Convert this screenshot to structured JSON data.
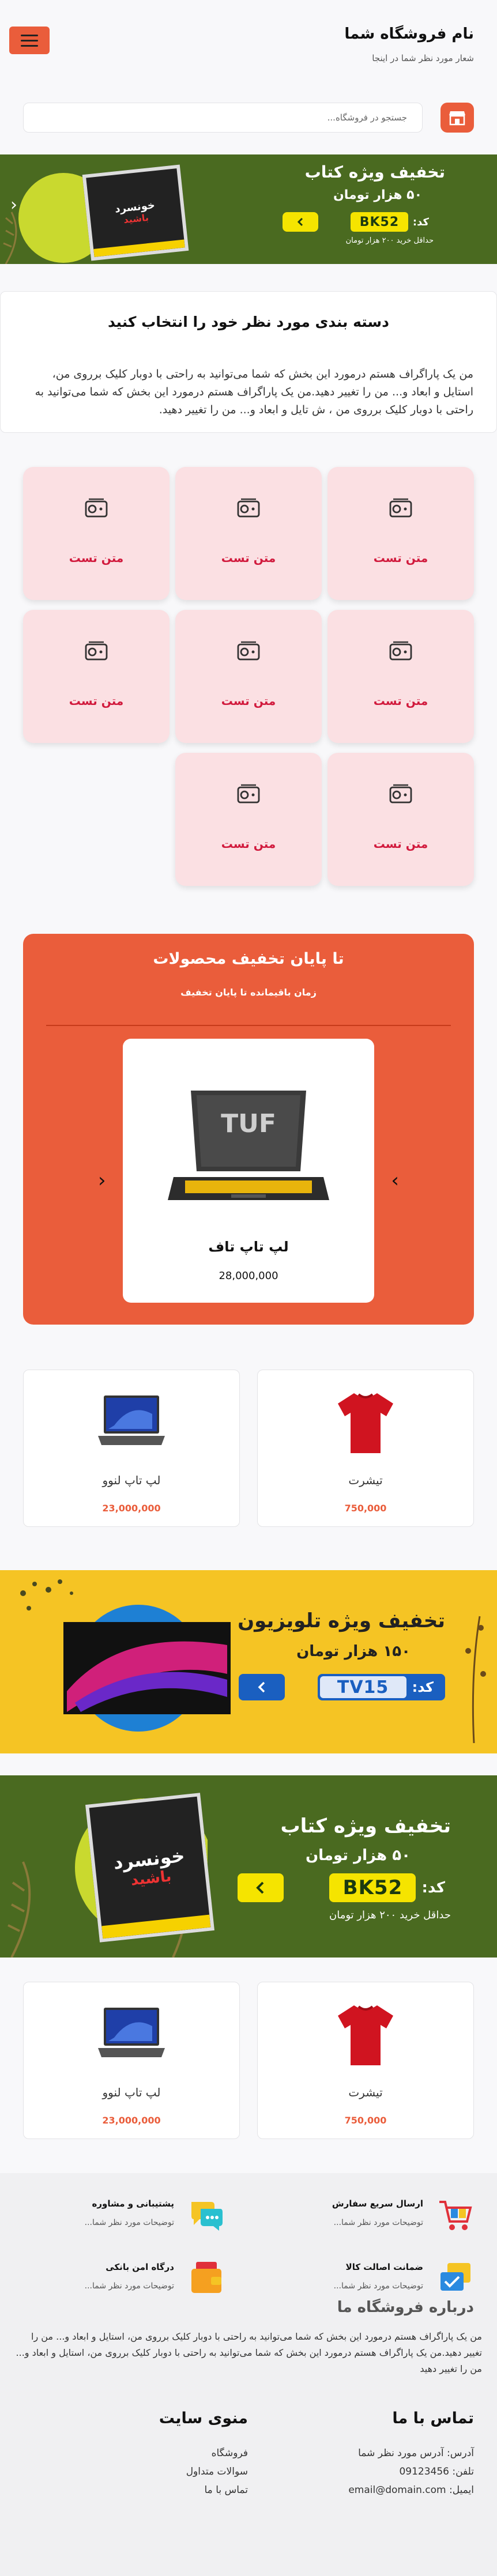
{
  "header": {
    "store_name": "نام فروشگاه شما",
    "slogan": "شعار مورد نظر شما در اینجا"
  },
  "search": {
    "placeholder": "جستجو در فروشگاه..."
  },
  "banner_book": {
    "title": "تخفیف ویژه کتاب",
    "amount": "۵۰ هزار تومان",
    "code_label": "کد:",
    "code": "BK52",
    "note": "حداقل خرید ۲۰۰ هزار تومان"
  },
  "banner_tv": {
    "title": "تخفیف ویژه تلویزیون",
    "amount": "۱۵۰ هزار تومان",
    "code_label": "کد:",
    "code": "TV15"
  },
  "categories": {
    "title": "دسته بندی مورد نظر خود را انتخاب کنید",
    "text": "من یک پاراگراف هستم درمورد این بخش که شما می‌توانید به راحتی با دوبار کلیک برروی من، استایل و ابعاد و... من را تغییر دهید.من یک پاراگراف هستم درمورد این بخش که شما می‌توانید به راحتی با دوبار کلیک برروی من ، ش تایل و ابعاد و... من را تغییر دهید.",
    "items": [
      {
        "label": "متن تست",
        "icon": "radio-icon"
      },
      {
        "label": "متن تست",
        "icon": "radio-icon"
      },
      {
        "label": "متن تست",
        "icon": "radio-icon"
      },
      {
        "label": "متن تست",
        "icon": "radio-icon"
      },
      {
        "label": "متن تست",
        "icon": "radio-icon"
      },
      {
        "label": "متن تست",
        "icon": "radio-icon"
      },
      {
        "label": "متن تست",
        "icon": "radio-icon"
      },
      {
        "label": "متن تست",
        "icon": "radio-icon"
      }
    ]
  },
  "discount": {
    "title": "تا پایان تخفیف محصولات",
    "subtitle": "زمان باقیمانده تا پایان تخفیف",
    "product": {
      "name": "لپ تاپ تاف",
      "price": "28,000,000",
      "brand": "TUF"
    }
  },
  "products_row1": [
    {
      "name": "تیشرت",
      "price": "750,000"
    },
    {
      "name": "لپ تاپ لنوو",
      "price": "23,000,000"
    }
  ],
  "products_row2": [
    {
      "name": "تیشرت",
      "price": "750,000"
    },
    {
      "name": "لپ تاپ لنوو",
      "price": "23,000,000"
    }
  ],
  "features": [
    {
      "title": "ارسال سریع سفارش",
      "desc": "توضیحات مورد نظر شما...",
      "icon": "shopping-cart-icon"
    },
    {
      "title": "پشتیبانی و مشاوره",
      "desc": "توضیحات مورد نظر شما...",
      "icon": "chat-icon"
    },
    {
      "title": "ضمانت اصالت کالا",
      "desc": "توضیحات مورد نظر شما...",
      "icon": "badge-icon"
    },
    {
      "title": "درگاه امن بانکی",
      "desc": "توضیحات مورد نظر شما...",
      "icon": "wallet-icon"
    }
  ],
  "about": {
    "title": "درباره فروشگاه ما",
    "text": "من یک پاراگراف هستم درمورد این بخش که شما می‌توانید به راحتی با دوبار کلیک برروی من، استایل و ابعاد و... من را تغییر دهید.من یک پاراگراف هستم درمورد این بخش که شما می‌توانید به راحتی با دوبار کلیک برروی من، استایل و ابعاد و... من را تغییر دهید"
  },
  "contact": {
    "title": "تماس با ما",
    "address": "آدرس: آدرس مورد نظر شما",
    "phone": "تلفن: 09123456",
    "email": "ایمیل: email@domain.com"
  },
  "site_menu": {
    "title": "منوی سایت",
    "items": [
      "فروشگاه",
      "سوالات متداول",
      "تماس با ما"
    ]
  },
  "colors": {
    "accent": "#ea5d3b",
    "category_bg": "#fbe0e3",
    "category_text": "#d11a3d",
    "banner_green": "#4a6a20",
    "banner_yellow": "#f5c424"
  }
}
